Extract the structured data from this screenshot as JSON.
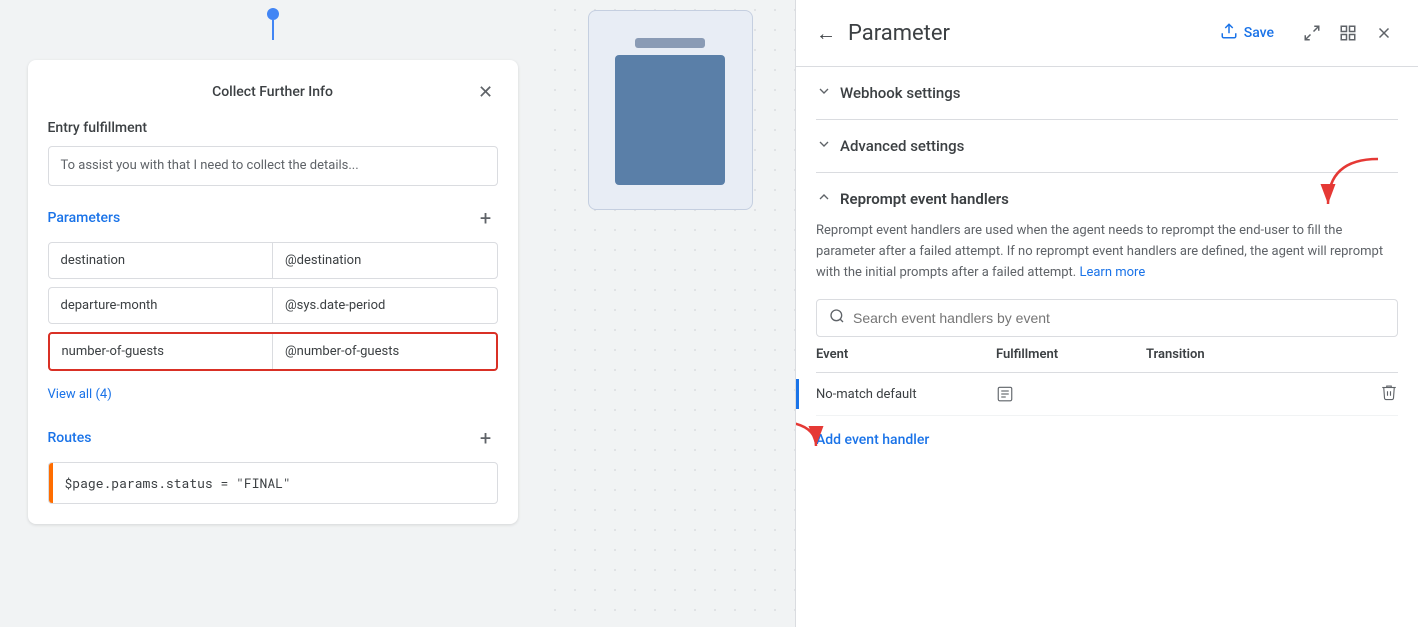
{
  "left_panel": {
    "card_title": "Collect Further Info",
    "entry_fulfillment_label": "Entry fulfillment",
    "fulfillment_text": "To assist you with that I need to collect the details...",
    "parameters_label": "Parameters",
    "add_param_tooltip": "+",
    "params": [
      {
        "name": "destination",
        "value": "@destination"
      },
      {
        "name": "departure-month",
        "value": "@sys.date-period"
      },
      {
        "name": "number-of-guests",
        "value": "@number-of-guests",
        "selected": true
      }
    ],
    "view_all_label": "View all (4)",
    "routes_label": "Routes",
    "route_value": "$page.params.status = \"FINAL\""
  },
  "right_panel": {
    "back_icon": "←",
    "title": "Parameter",
    "save_label": "Save",
    "save_icon": "⬆",
    "toolbar": {
      "expand_icon": "⤢",
      "grid_icon": "⊞",
      "close_icon": "✕"
    },
    "webhook_settings_label": "Webhook settings",
    "advanced_settings_label": "Advanced settings",
    "reprompt_section": {
      "title": "Reprompt event handlers",
      "description": "Reprompt event handlers are used when the agent needs to reprompt the end-user to fill the parameter after a failed attempt. If no reprompt event handlers are defined, the agent will reprompt with the initial prompts after a failed attempt.",
      "learn_more_label": "Learn more",
      "search_placeholder": "Search event handlers by event",
      "table": {
        "columns": [
          "Event",
          "Fulfillment",
          "Transition"
        ],
        "rows": [
          {
            "event": "No-match default",
            "fulfillment_icon": "📋",
            "transition": ""
          }
        ]
      },
      "add_handler_label": "Add event handler"
    }
  }
}
